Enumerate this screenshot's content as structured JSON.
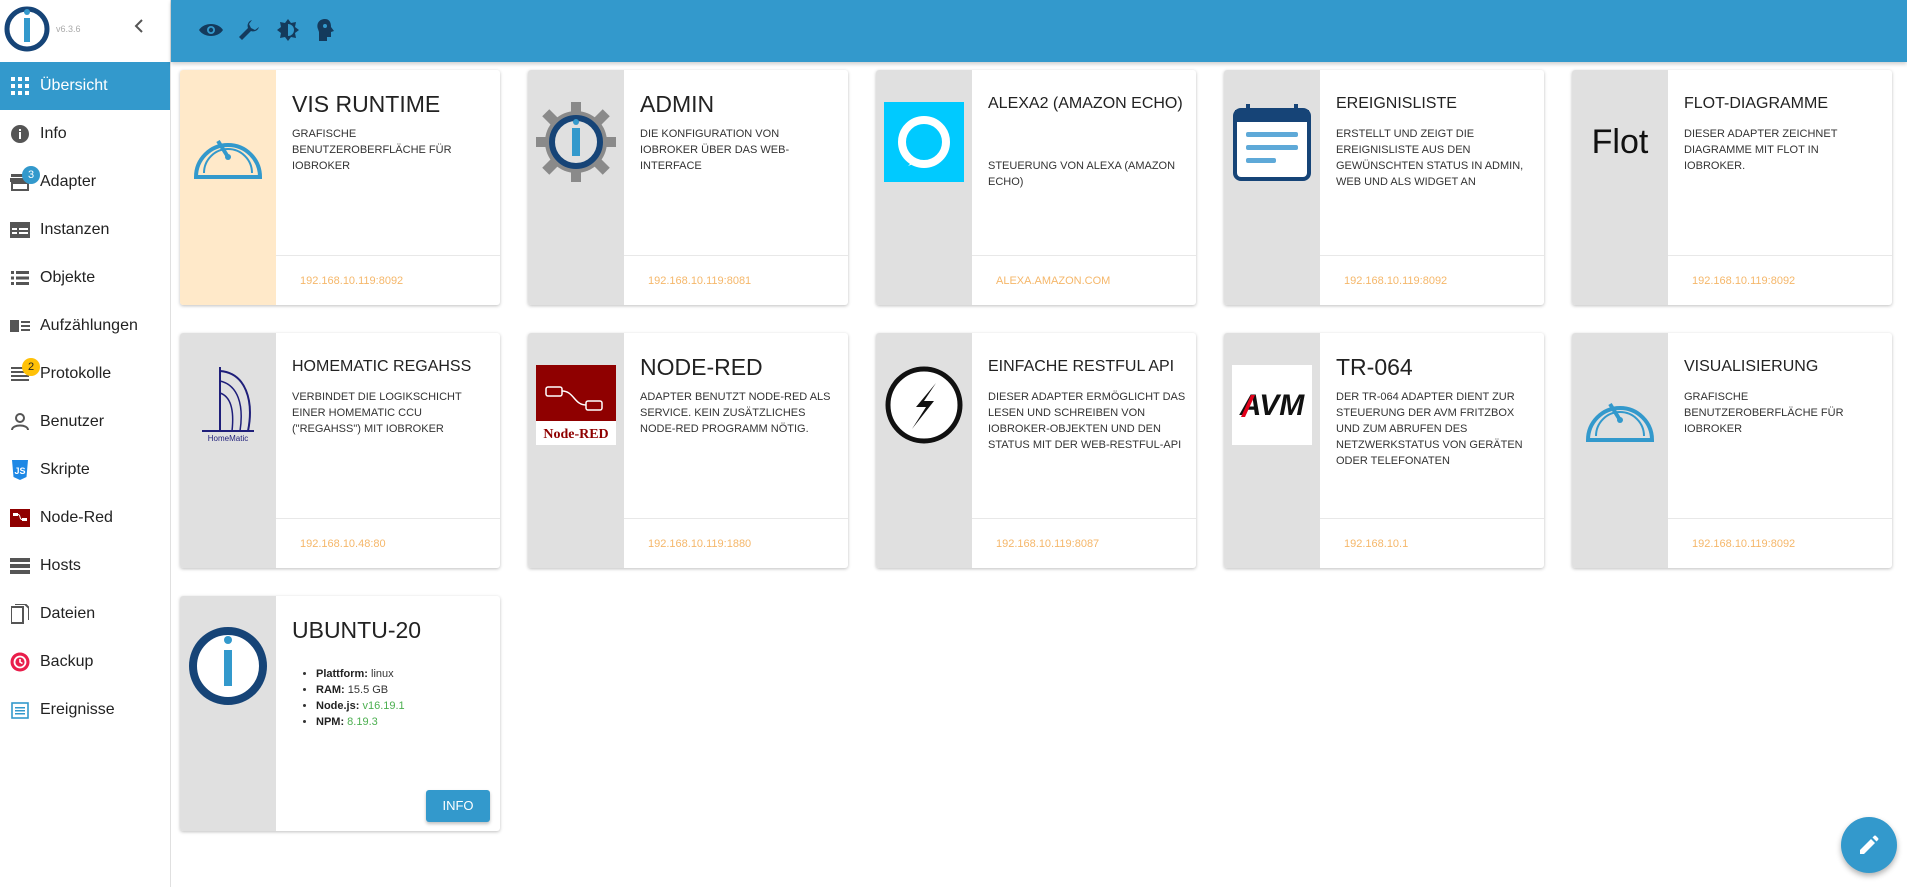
{
  "app": {
    "version": "v6.3.6"
  },
  "sidebar": {
    "items": [
      {
        "label": "Übersicht",
        "icon": "grid-icon",
        "active": true
      },
      {
        "label": "Info",
        "icon": "info-icon"
      },
      {
        "label": "Adapter",
        "icon": "store-icon",
        "badge": "3"
      },
      {
        "label": "Instanzen",
        "icon": "instances-icon"
      },
      {
        "label": "Objekte",
        "icon": "list-icon"
      },
      {
        "label": "Aufzählungen",
        "icon": "enum-icon"
      },
      {
        "label": "Protokolle",
        "icon": "log-icon",
        "badge": "2"
      },
      {
        "label": "Benutzer",
        "icon": "user-icon"
      },
      {
        "label": "Skripte",
        "icon": "js-icon"
      },
      {
        "label": "Node-Red",
        "icon": "node-red-icon"
      },
      {
        "label": "Hosts",
        "icon": "hosts-icon"
      },
      {
        "label": "Dateien",
        "icon": "files-icon"
      },
      {
        "label": "Backup",
        "icon": "backup-icon"
      },
      {
        "label": "Ereignisse",
        "icon": "events-icon"
      }
    ]
  },
  "toolbar": {
    "icons": [
      "eye-icon",
      "wrench-icon",
      "theme-icon",
      "expert-mode-icon"
    ]
  },
  "cards": [
    {
      "title": "VIS RUNTIME",
      "desc": "Grafische Benutzeroberfläche für ioBroker",
      "link": "192.168.10.119:8092",
      "icon": "gauge-icon"
    },
    {
      "title": "ADMIN",
      "desc": "Die Konfiguration von ioBroker über das Web-Interface",
      "link": "192.168.10.119:8081",
      "icon": "iobroker-gear-icon"
    },
    {
      "title": "ALEXA2 (AMAZON ECHO)",
      "desc": "Steuerung von Alexa (Amazon Echo)",
      "link": "ALEXA.AMAZON.COM",
      "icon": "alexa-icon"
    },
    {
      "title": "EREIGNISLISTE",
      "desc": "Erstellt und zeigt die Ereignisliste aus den gewünschten Status in Admin, Web und als Widget an",
      "link": "192.168.10.119:8092",
      "icon": "calendar-icon"
    },
    {
      "title": "FLOT-DIAGRAMME",
      "desc": "Dieser Adapter zeichnet Diagramme mit Flot in ioBroker.",
      "link": "192.168.10.119:8092",
      "icon": "flot-icon",
      "icon_text": "Flot"
    },
    {
      "title": "HOMEMATIC REGAHSS",
      "desc": "Verbindet die Logikschicht einer HomeMatic CCU (\"ReGaHSS\") mit ioBroker",
      "link": "192.168.10.48:80",
      "icon": "homematic-icon",
      "icon_text": "HomeMatic"
    },
    {
      "title": "NODE-RED",
      "desc": "Adapter benutzt node-red als service. Kein zusätzliches node-red programm nötig.",
      "link": "192.168.10.119:1880",
      "icon": "node-red-logo-icon",
      "icon_text": "Node-RED"
    },
    {
      "title": "EINFACHE RESTFUL API",
      "desc": "Dieser Adapter ermöglicht das Lesen und Schreiben von ioBroker-Objekten und den Status mit der Web-RESTful-API",
      "link": "192.168.10.119:8087",
      "icon": "lightning-icon"
    },
    {
      "title": "TR-064",
      "desc": "Der TR-064 Adapter dient zur Steuerung der AVM Fritzbox und zum Abrufen des Netzwerkstatus von Geräten oder Telefonaten",
      "link": "192.168.10.1",
      "icon": "avm-icon",
      "icon_text": "AVM"
    },
    {
      "title": "VISUALISIERUNG",
      "desc": "Grafische Benutzeroberfläche für ioBroker",
      "link": "192.168.10.119:8092",
      "icon": "gauge-icon"
    }
  ],
  "host": {
    "title": "UBUNTU-20",
    "platform_label": "Plattform:",
    "platform": "linux",
    "ram_label": "RAM:",
    "ram": "15.5 GB",
    "node_label": "Node.js:",
    "node": "v16.19.1",
    "npm_label": "NPM:",
    "npm": "8.19.3",
    "button": "INFO"
  },
  "colors": {
    "primary": "#3399cc",
    "link": "#f5b76a",
    "vis_bg": "#ffe9c9"
  },
  "fab": {
    "icon": "edit-pencil-icon"
  }
}
